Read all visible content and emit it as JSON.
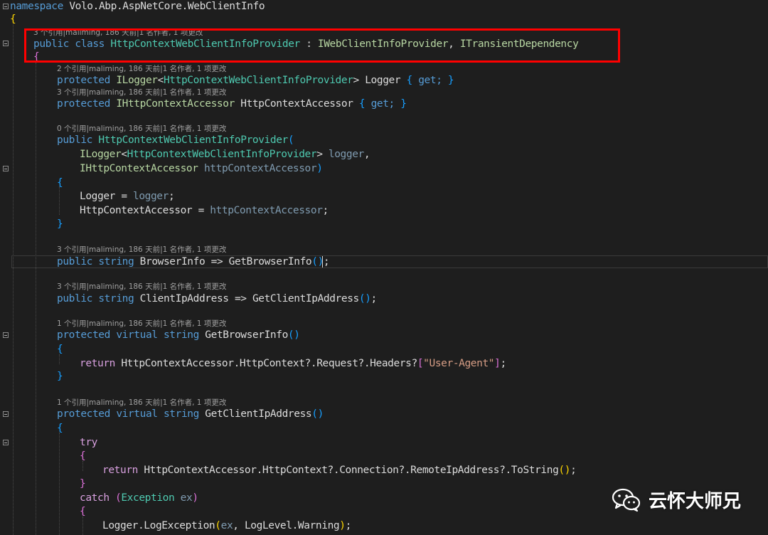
{
  "editor": {
    "namespace_kw": "namespace",
    "namespace_name": "Volo.Abp.AspNetCore.WebClientInfo",
    "lens_class": "3 个引用|maliming, 186 天前|1 名作者, 1 项更改",
    "lens_logger": "2 个引用|maliming, 186 天前|1 名作者, 1 项更改",
    "lens_accessor": "3 个引用|maliming, 186 天前|1 名作者, 1 项更改",
    "lens_ctor": "0 个引用|maliming, 186 天前|1 名作者, 1 项更改",
    "lens_browserinfo": "3 个引用|maliming, 186 天前|1 名作者, 1 项更改",
    "lens_clientip": "3 个引用|maliming, 186 天前|1 名作者, 1 项更改",
    "lens_getbrowser": "1 个引用|maliming, 186 天前|1 名作者, 1 项更改",
    "lens_getclientip": "1 个引用|maliming, 186 天前|1 名作者, 1 项更改",
    "kw_public": "public",
    "kw_class": "class",
    "kw_protected": "protected",
    "kw_get": "get;",
    "kw_string": "string",
    "kw_virtual": "virtual",
    "kw_return": "return",
    "kw_try": "try",
    "kw_catch": "catch",
    "class_name": "HttpContextWebClientInfoProvider",
    "iface1": "IWebClientInfoProvider",
    "iface2": "ITransientDependency",
    "ilogger": "ILogger",
    "ihttp": "IHttpContextAccessor",
    "prop_logger": "Logger",
    "prop_accessor": "HttpContextAccessor",
    "param_logger": "logger",
    "param_accessor": "httpContextAccessor",
    "prop_browserinfo": "BrowserInfo",
    "prop_clientip": "ClientIpAddress",
    "m_getbrowser": "GetBrowserInfo",
    "m_getclientip": "GetClientIpAddress",
    "expr_headers": "HttpContextAccessor.HttpContext?.Request?.Headers?",
    "str_useragent": "\"User-Agent\"",
    "expr_remoteip": "HttpContextAccessor.HttpContext?.Connection?.RemoteIpAddress?.",
    "m_tostring": "ToString",
    "exception_type": "Exception",
    "exception_var": "ex",
    "log_call": "Logger.LogException",
    "log_level": "LogLevel.Warning"
  },
  "watermark": {
    "text": "云怀大师兄",
    "icon": "wechat-icon"
  }
}
